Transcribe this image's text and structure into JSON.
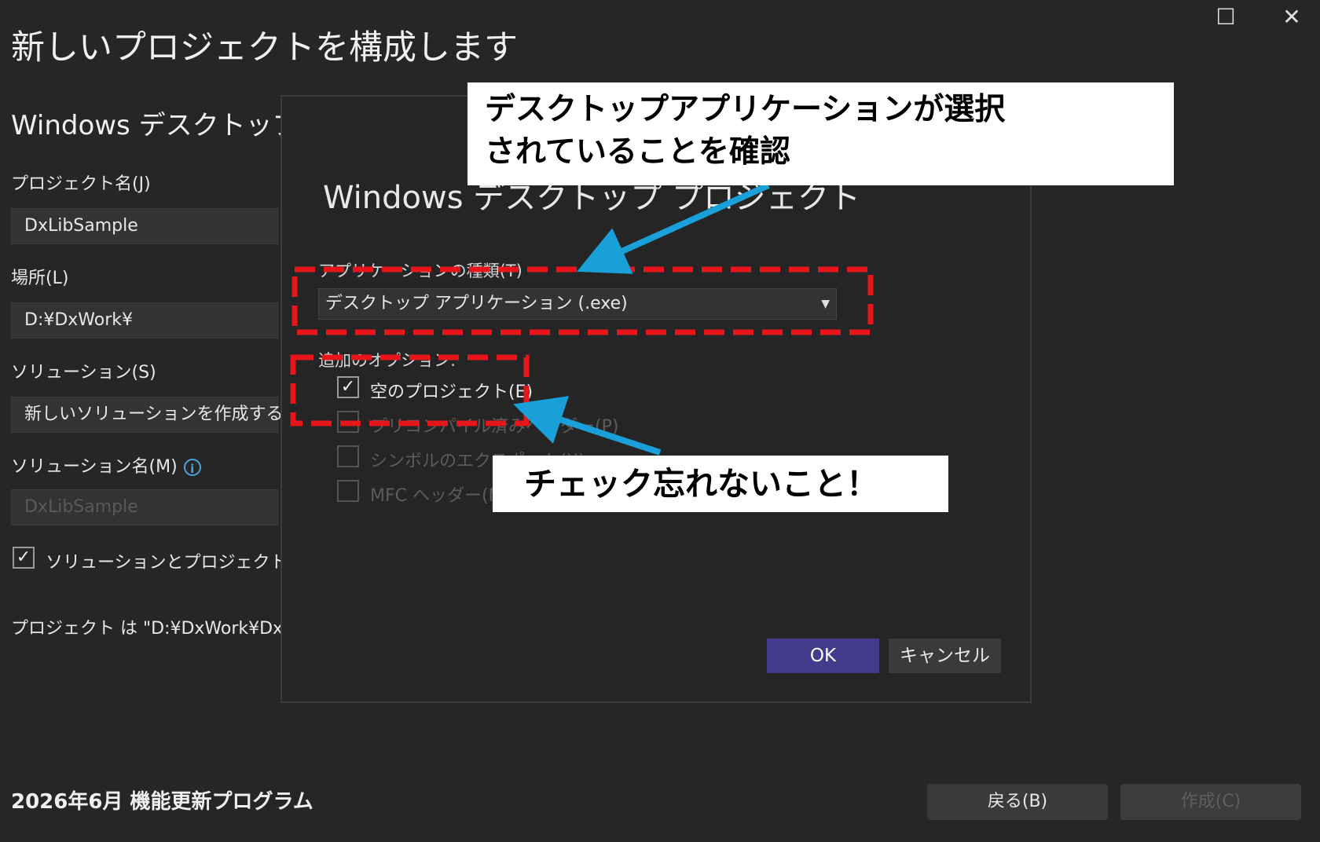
{
  "window": {
    "maximize_glyph": "☐",
    "close_glyph": "✕"
  },
  "page_title": "新しいプロジェクトを構成します",
  "section_title": "Windows デスクトップ ウ",
  "form": {
    "project_name_label": "プロジェクト名(J)",
    "project_name_value": "DxLibSample",
    "location_label": "場所(L)",
    "location_value": "D:¥DxWork¥",
    "solution_label": "ソリューション(S)",
    "solution_value": "新しいソリューションを作成する",
    "solution_name_label": "ソリューション名(M)",
    "solution_name_value": "DxLibSample",
    "info_glyph": "i",
    "same_dir_checkbox_glyph": "✓",
    "same_dir_label": "ソリューションとプロジェクトを同じデ",
    "project_path_text": "プロジェクト は \"D:¥DxWork¥DxLibSa"
  },
  "dialog": {
    "title": "Windows デスクトップ プロジェクト",
    "app_type_label": "アプリケーションの種類(T)",
    "app_type_value": "デスクトップ アプリケーション (.exe)",
    "combo_arrow_glyph": "▼",
    "options_label": "追加のオプション:",
    "options": [
      {
        "label": "空のプロジェクト(E)",
        "checked": true,
        "glyph": "✓"
      },
      {
        "label": "プリコンパイル済みヘッダー(P)",
        "checked": false,
        "glyph": ""
      },
      {
        "label": "シンボルのエクスポート(X)",
        "checked": false,
        "glyph": ""
      },
      {
        "label": "MFC ヘッダー(M)",
        "checked": false,
        "glyph": ""
      }
    ],
    "ok_label": "OK",
    "cancel_label": "キャンセル"
  },
  "annotations": {
    "callout1_line1": "デスクトップアプリケーションが選択",
    "callout1_line2": "されていることを確認",
    "callout2": "チェック忘れないこと！",
    "dash_color": "#e8161b",
    "arrow_color": "#1aa0d8"
  },
  "footer": {
    "update_text": "2026年6月 機能更新プログラム",
    "back_label": "戻る(B)",
    "create_label": "作成(C)"
  },
  "colors": {
    "background": "#262626",
    "accent_button": "#443b8c",
    "info_blue": "#4aa3df"
  }
}
